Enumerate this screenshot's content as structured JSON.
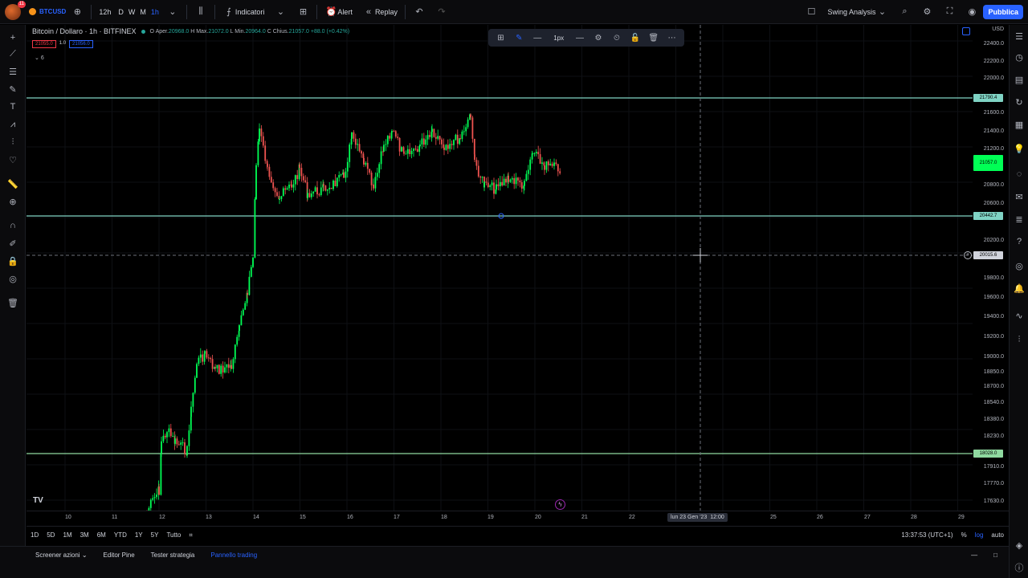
{
  "topbar": {
    "avatar_badge": "11",
    "symbol": "BTCUSD",
    "intervals": [
      "12h",
      "D",
      "W",
      "M",
      "1h"
    ],
    "indicators_label": "Indicatori",
    "alert_label": "Alert",
    "replay_label": "Replay",
    "layout_name": "Swing Analysis",
    "publish_label": "Pubblica"
  },
  "legend": {
    "title": "Bitcoin / Dollaro · 1h · BITFINEX",
    "open_label": "O",
    "open_text": "Aper.",
    "open": "20968.0",
    "high_label": "H",
    "high_text": "Max.",
    "high": "21072.0",
    "low_label": "L",
    "low_text": "Min.",
    "low": "20964.0",
    "close_label": "C",
    "close_text": "Chius.",
    "close": "21057.0",
    "change": "+88.0 (+0.42%)",
    "bid": "21055.0",
    "spread": "1.0",
    "ask": "21056.0",
    "collapse": "6"
  },
  "drawing_toolbar": {
    "width_label": "1px"
  },
  "price_axis": {
    "currency": "USD",
    "ticks": [
      "22400.0",
      "22200.0",
      "22000.0",
      "21600.0",
      "21400.0",
      "21200.0",
      "20800.0",
      "20600.0",
      "20200.0",
      "19800.0",
      "19600.0",
      "19400.0",
      "19200.0",
      "19000.0",
      "18850.0",
      "18700.0",
      "18540.0",
      "18380.0",
      "18230.0",
      "17910.0",
      "17770.0",
      "17630.0"
    ],
    "tags": {
      "resistance": "21790.4",
      "current": "21057.0",
      "support": "20442.7",
      "cursor": "20015.6",
      "low_line": "18028.0"
    }
  },
  "time_axis": {
    "ticks": [
      "10",
      "11",
      "12",
      "13",
      "14",
      "15",
      "16",
      "17",
      "18",
      "19",
      "20",
      "21",
      "22",
      "25",
      "26",
      "27",
      "28",
      "29"
    ],
    "cursor_date": "lun 23 Gen '23",
    "cursor_time": "12:00"
  },
  "range_bar": {
    "ranges": [
      "1D",
      "5D",
      "1M",
      "3M",
      "6M",
      "YTD",
      "1Y",
      "5Y",
      "Tutto"
    ],
    "clock": "13:37:53 (UTC+1)",
    "percent": "%",
    "log": "log",
    "auto": "auto"
  },
  "bottom_tabs": [
    "Screener azioni",
    "Editor Pine",
    "Tester strategia",
    "Pannello trading"
  ],
  "colors": {
    "up": "#26a69a",
    "up_bright": "#00ff55",
    "down": "#ef5350",
    "line": "#7fd3c4",
    "accent": "#2962ff"
  }
}
